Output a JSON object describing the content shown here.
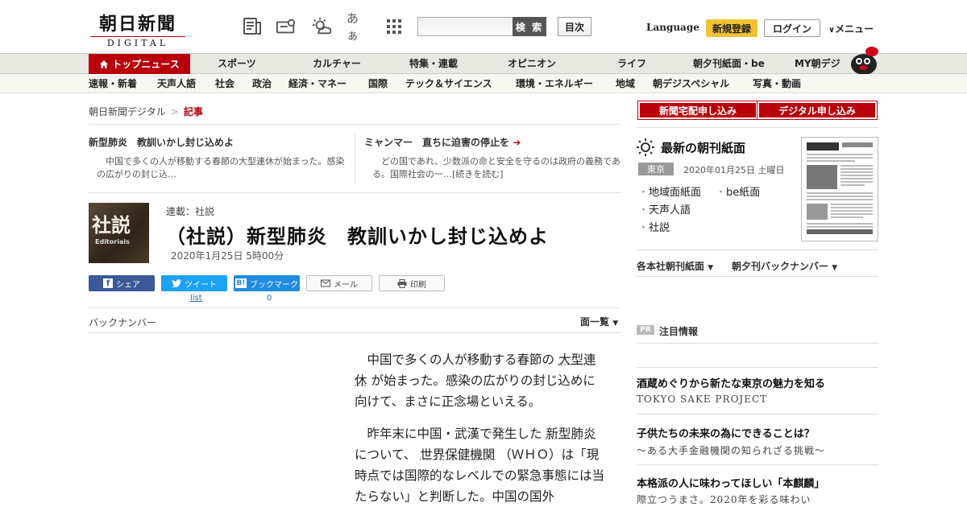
{
  "header": {
    "logo_main": "朝日新聞",
    "logo_sub": "DIGITAL",
    "search_button": "検 索",
    "toc_button": "目次",
    "language": "Language",
    "signup": "新規登録",
    "login": "ログイン",
    "menu": "メニュー",
    "kana_icon_text": "あぁ"
  },
  "nav_primary": {
    "top": "トップニュース",
    "items": [
      "スポーツ",
      "カルチャー",
      "特集・連載",
      "オピニオン",
      "ライフ",
      "朝夕刊紙面・be",
      "MY朝デジ"
    ]
  },
  "nav_secondary": {
    "items": [
      "速報・新着",
      "天声人語",
      "社会",
      "政治",
      "経済・マネー",
      "国際",
      "テック＆サイエンス",
      "環境・エネルギー",
      "地域",
      "朝デジスペシャル",
      "写真・動画"
    ]
  },
  "breadcrumb": {
    "home": "朝日新聞デジタル",
    "sep": ">",
    "current": "記事"
  },
  "teasers": [
    {
      "title": "新型肺炎　教訓いかし封じ込めよ",
      "body": "　中国で多くの人が移動する春節の大型連休が始まった。感染の広がりの封じ込…"
    },
    {
      "title": "ミャンマー　直ちに迫害の停止を",
      "body": "　どの国であれ、少数派の命と安全を守るのは政府の義務である。国際社会の一…[続きを読む]"
    }
  ],
  "article": {
    "badge_kanji": "社説",
    "badge_en": "Editorials",
    "series": "連載：社説",
    "title": "（社説）新型肺炎　教訓いかし封じ込めよ",
    "date": "2020年1月25日 5時00分",
    "share": {
      "facebook": "シェア",
      "twitter": "ツイート",
      "hatena": "ブックマーク",
      "mail": "メール",
      "print": "印刷",
      "twitter_count": "list",
      "hatena_count": "0"
    },
    "back_number": "バックナンバー",
    "page_list": "面一覧",
    "p1_a": "中国で多くの人が移動する春節の",
    "p1_link": "大型連休",
    "p1_b": "が始まった。感染の広がりの封じ込めに向けて、まさに正念場といえる。",
    "p2_a": "昨年末に中国・武漢で発生した",
    "p2_link1": "新型肺炎",
    "p2_b": "について、",
    "p2_link2": "世界保健機関",
    "p2_c": "（ＷＨＯ）は「現時点では国際的なレベルでの緊急事態には当たらない」と判断した。中国の国外"
  },
  "sidebar": {
    "btn_home_delivery": "新聞宅配申し込み",
    "btn_digital": "デジタル申し込み",
    "latest_title": "最新の朝刊紙面",
    "region": "東京",
    "latest_date": "2020年01月25日 土曜日",
    "links": [
      "地域面紙面",
      "be紙面",
      "天声人語",
      "社説"
    ],
    "dropdown1": "各本社朝刊紙面",
    "dropdown2": "朝夕刊バックナンバー",
    "pr_badge": "PR",
    "pr_title": "注目情報",
    "ads": [
      {
        "title": "酒蔵めぐりから新たな東京の魅力を知る",
        "sub": "TOKYO SAKE PROJECT"
      },
      {
        "title": "子供たちの未来の為にできることは？",
        "sub": "～ある大手金融機関の知られざる挑戦～"
      },
      {
        "title": "本格派の人に味わってほしい「本麒麟」",
        "sub": "際立つうまさ。2020年を彩る味わい"
      }
    ]
  },
  "colors": {
    "accent": "#b8000a",
    "signup": "#f1c232",
    "facebook": "#3b5998",
    "twitter": "#1da1f2",
    "hatena": "#1f8ce0"
  }
}
